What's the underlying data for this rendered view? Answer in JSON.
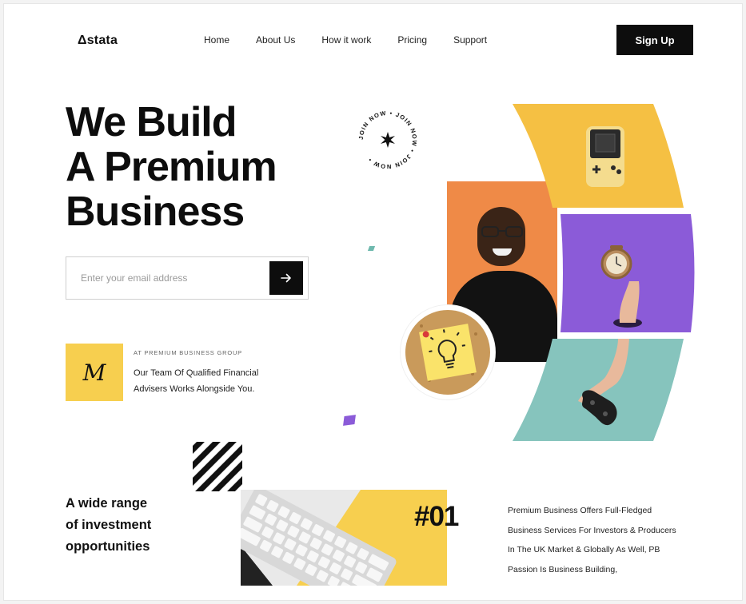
{
  "header": {
    "logo": "Δstata",
    "nav": [
      "Home",
      "About Us",
      "How it work",
      "Pricing",
      "Support"
    ],
    "signup_label": "Sign Up"
  },
  "hero": {
    "title_lines": [
      "We Build",
      "A Premium",
      "Business"
    ],
    "email_placeholder": "Enter your email address",
    "submit_icon": "arrow-right-icon",
    "join_badge_text": "JOIN NOW • JOIN NOW • JOIN NOW •",
    "badge_letter": "M",
    "eyebrow": "AT PREMIUM BUSINESS GROUP",
    "team_text": "Our Team Of Qualified Financial Advisers Works Alongside You."
  },
  "bottom": {
    "range_lines": [
      "A wide range",
      "of investment",
      "opportunities"
    ],
    "number": "#01",
    "description_lines": [
      "Premium Business Offers Full-Fledged",
      "Business Services For Investors & Producers",
      "In The UK Market & Globally As Well, PB",
      "Passion Is Business Building,"
    ]
  },
  "colors": {
    "yellow": "#f5c043",
    "purple": "#8b5bd8",
    "teal": "#86c4bd",
    "orange": "#ef8a47",
    "badge_yellow": "#f7cf4f",
    "dark": "#0d0d0d"
  }
}
